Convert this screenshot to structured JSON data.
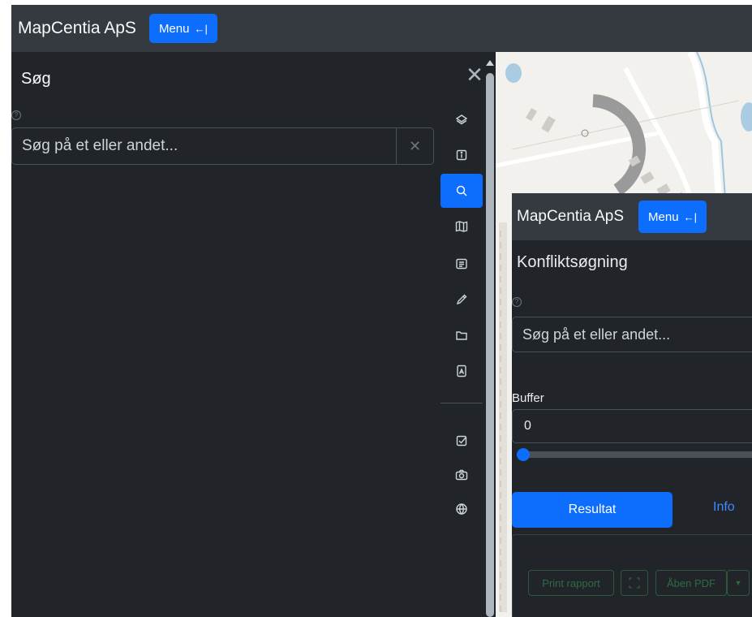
{
  "app": {
    "brand": "MapCentia ApS",
    "menu_label": "Menu",
    "menu_icon": "←|"
  },
  "search_panel": {
    "title": "Søg",
    "close_icon": "✕",
    "help_icon": "?",
    "search_placeholder": "Søg på et eller andet...",
    "clear_icon": "✕"
  },
  "toolbar": {
    "items": [
      {
        "name": "layers-icon"
      },
      {
        "name": "info-icon"
      },
      {
        "name": "search-icon",
        "active": true
      },
      {
        "name": "map-icon"
      },
      {
        "name": "legend-icon"
      },
      {
        "name": "draw-icon"
      },
      {
        "name": "folder-icon"
      },
      {
        "name": "pdf-icon"
      },
      {
        "name": "checkbox-icon"
      },
      {
        "name": "camera-icon"
      },
      {
        "name": "globe-icon"
      }
    ]
  },
  "overlay": {
    "brand": "MapCentia ApS",
    "menu_label": "Menu",
    "menu_icon": "←|",
    "title": "Konfliktsøgning",
    "help_icon": "?",
    "search_placeholder": "Søg på et eller andet...",
    "buffer_label": "Buffer",
    "buffer_value": "0",
    "buffer_slider_fraction": 0,
    "tab_result": "Resultat",
    "tab_info": "Info",
    "print_button": "Print rapport",
    "open_pdf_button": "Åben PDF"
  },
  "colors": {
    "accent": "#0d6efd",
    "navbar": "#343a40",
    "panel": "#212529"
  }
}
